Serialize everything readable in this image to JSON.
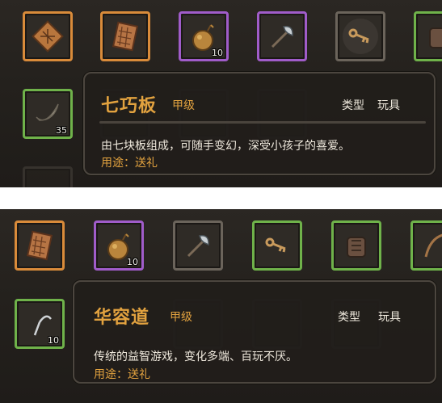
{
  "top": {
    "row1": [
      {
        "frame": "orange",
        "icon": "tangram-board-icon",
        "count": ""
      },
      {
        "frame": "orange",
        "icon": "checker-board-icon",
        "count": ""
      },
      {
        "frame": "purple",
        "icon": "gourd-icon",
        "count": "10"
      },
      {
        "frame": "purple",
        "icon": "battle-axe-icon",
        "count": ""
      },
      {
        "frame": "gray",
        "icon": "key-icon",
        "count": ""
      },
      {
        "frame": "green",
        "icon": "armor-icon",
        "count": ""
      }
    ],
    "row2": [
      {
        "frame": "green",
        "icon": "horn-icon",
        "count": "35"
      }
    ],
    "tooltip": {
      "name": "七巧板",
      "grade": "甲级",
      "type_label": "类型",
      "type_value": "玩具",
      "description": "由七块板组成，可随手变幻，深受小孩子的喜爱。",
      "usage": "用途：送礼"
    }
  },
  "bottom": {
    "row1": [
      {
        "frame": "orange",
        "icon": "checker-board-icon",
        "count": ""
      },
      {
        "frame": "purple",
        "icon": "gourd-icon",
        "count": "10"
      },
      {
        "frame": "gray",
        "icon": "battle-axe-icon",
        "count": ""
      },
      {
        "frame": "green",
        "icon": "key-icon",
        "count": ""
      },
      {
        "frame": "green",
        "icon": "armor-icon",
        "count": ""
      },
      {
        "frame": "green",
        "icon": "bow-icon",
        "count": ""
      }
    ],
    "row2": [
      {
        "frame": "green",
        "icon": "sickle-icon",
        "count": "10"
      }
    ],
    "tooltip": {
      "name": "华容道",
      "grade": "甲级",
      "type_label": "类型",
      "type_value": "玩具",
      "description": "传统的益智游戏，变化多端、百玩不厌。",
      "usage": "用途：送礼"
    }
  },
  "colors": {
    "orange_frame": "#d98b3a",
    "purple_frame": "#a05cc9",
    "green_frame": "#6fb24a",
    "gold_text": "#e2a23f",
    "light_text": "#efe9dd"
  }
}
